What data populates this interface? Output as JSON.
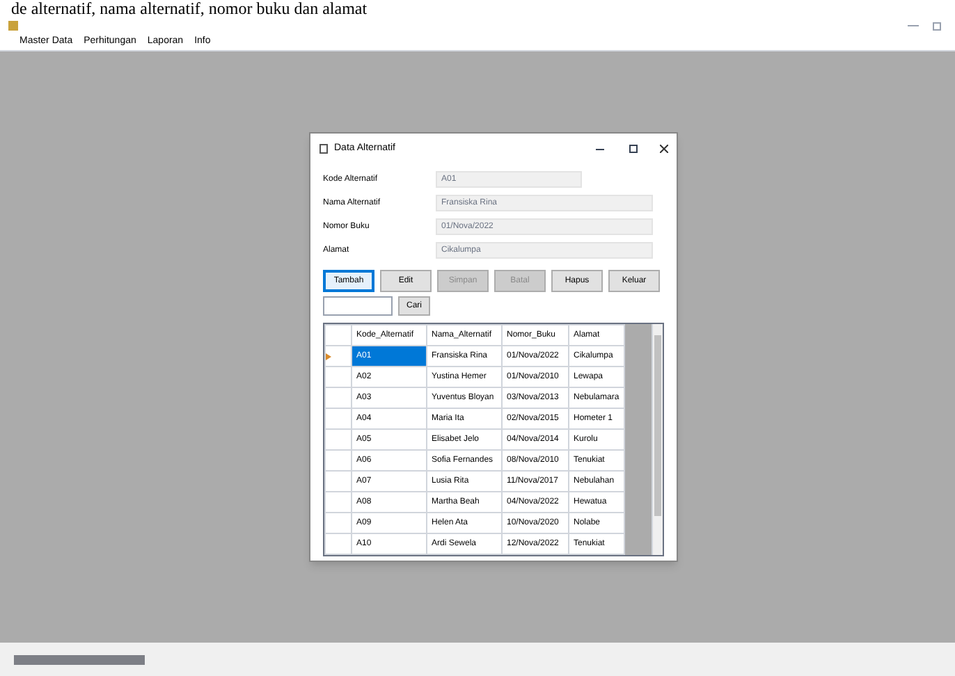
{
  "document_text": "de alternatif, nama alternatif, nomor buku dan alamat",
  "menu": [
    "Master Data",
    "Perhitungan",
    "Laporan",
    "Info"
  ],
  "dialog": {
    "title": "Data Alternatif",
    "fields": [
      {
        "label": "Kode Alternatif",
        "value": "A01",
        "short": true
      },
      {
        "label": "Nama Alternatif",
        "value": "Fransiska Rina",
        "short": false
      },
      {
        "label": "Nomor Buku",
        "value": "01/Nova/2022",
        "short": false
      },
      {
        "label": "Alamat",
        "value": "Cikalumpa",
        "short": false
      }
    ],
    "buttons": [
      {
        "label": "Tambah",
        "disabled": false,
        "focused": true
      },
      {
        "label": "Edit",
        "disabled": false,
        "focused": false
      },
      {
        "label": "Simpan",
        "disabled": true,
        "focused": false
      },
      {
        "label": "Batal",
        "disabled": true,
        "focused": false
      },
      {
        "label": "Hapus",
        "disabled": false,
        "focused": false
      },
      {
        "label": "Keluar",
        "disabled": false,
        "focused": false
      }
    ],
    "search_button": "Cari",
    "table": {
      "columns": [
        "Kode_Alternatif",
        "Nama_Alternatif",
        "Nomor_Buku",
        "Alamat"
      ],
      "rows": [
        {
          "cells": [
            "A01",
            "Fransiska Rina",
            "01/Nova/2022",
            "Cikalumpa"
          ],
          "selected": true
        },
        {
          "cells": [
            "A02",
            "Yustina Hemer",
            "01/Nova/2010",
            "Lewapa"
          ],
          "selected": false
        },
        {
          "cells": [
            "A03",
            "Yuventus Bloyan",
            "03/Nova/2013",
            "Nebulamara"
          ],
          "selected": false
        },
        {
          "cells": [
            "A04",
            "Maria Ita",
            "02/Nova/2015",
            "Hometer 1"
          ],
          "selected": false
        },
        {
          "cells": [
            "A05",
            "Elisabet Jelo",
            "04/Nova/2014",
            "Kurolu"
          ],
          "selected": false
        },
        {
          "cells": [
            "A06",
            "Sofia Fernandes",
            "08/Nova/2010",
            "Tenukiat"
          ],
          "selected": false
        },
        {
          "cells": [
            "A07",
            "Lusia Rita",
            "11/Nova/2017",
            "Nebulahan"
          ],
          "selected": false
        },
        {
          "cells": [
            "A08",
            "Martha Beah",
            "04/Nova/2022",
            "Hewatua"
          ],
          "selected": false
        },
        {
          "cells": [
            "A09",
            "Helen Ata",
            "10/Nova/2020",
            "Nolabe"
          ],
          "selected": false
        },
        {
          "cells": [
            "A10",
            "Ardi Sewela",
            "12/Nova/2022",
            "Tenukiat"
          ],
          "selected": false
        }
      ]
    }
  }
}
